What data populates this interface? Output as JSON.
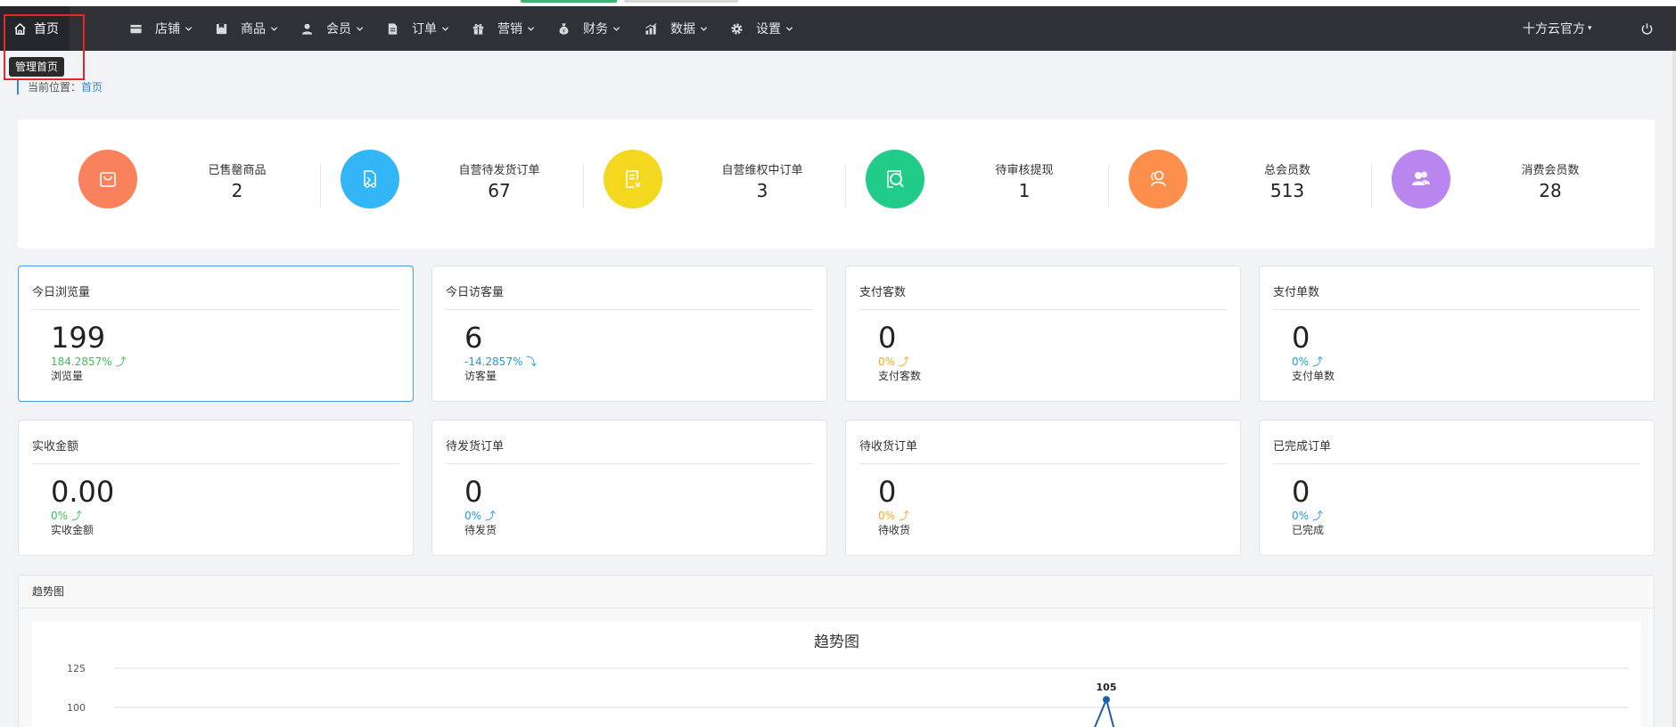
{
  "nav": {
    "home": "首页",
    "items": [
      {
        "label": "店铺",
        "icon": "store-icon"
      },
      {
        "label": "商品",
        "icon": "goods-icon"
      },
      {
        "label": "会员",
        "icon": "member-icon"
      },
      {
        "label": "订单",
        "icon": "order-icon"
      },
      {
        "label": "营销",
        "icon": "gift-icon"
      },
      {
        "label": "财务",
        "icon": "money-bag-icon"
      },
      {
        "label": "数据",
        "icon": "bar-chart-icon"
      },
      {
        "label": "设置",
        "icon": "gear-icon"
      }
    ],
    "account": "十方云官方",
    "tooltip": "管理首页"
  },
  "breadcrumb": {
    "prefix": "当前位置：",
    "link": "首页"
  },
  "stats": [
    {
      "label": "已售罄商品",
      "value": "2",
      "color": "#f9825d",
      "icon": "bag-icon"
    },
    {
      "label": "自营待发货订单",
      "value": "67",
      "color": "#33b6f7",
      "icon": "truck-icon"
    },
    {
      "label": "自营维权中订单",
      "value": "3",
      "color": "#f4d820",
      "icon": "refund-doc-icon"
    },
    {
      "label": "待审核提现",
      "value": "1",
      "color": "#21cb88",
      "icon": "search-doc-icon"
    },
    {
      "label": "总会员数",
      "value": "513",
      "color": "#fd8f4c",
      "icon": "members-icon"
    },
    {
      "label": "消费会员数",
      "value": "28",
      "color": "#b986f0",
      "icon": "users-icon"
    }
  ],
  "cards_row1": [
    {
      "title": "今日浏览量",
      "value": "199",
      "pct": "184.2857% ⤴",
      "pct_color": "#3fbf5b",
      "sub": "浏览量"
    },
    {
      "title": "今日访客量",
      "value": "6",
      "pct": "-14.2857% ⤵",
      "pct_color": "#1e9ad8",
      "sub": "访客量"
    },
    {
      "title": "支付客数",
      "value": "0",
      "pct": "0% ⤴",
      "pct_color": "#f5a623",
      "sub": "支付客数"
    },
    {
      "title": "支付单数",
      "value": "0",
      "pct": "0% ⤴",
      "pct_color": "#1e9ad8",
      "sub": "支付单数"
    }
  ],
  "cards_row2": [
    {
      "title": "实收金额",
      "value": "0.00",
      "pct": "0% ⤴",
      "pct_color": "#3fbf5b",
      "sub": "实收金额"
    },
    {
      "title": "待发货订单",
      "value": "0",
      "pct": "0% ⤴",
      "pct_color": "#1e9ad8",
      "sub": "待发货"
    },
    {
      "title": "待收货订单",
      "value": "0",
      "pct": "0% ⤴",
      "pct_color": "#f5a623",
      "sub": "待收货"
    },
    {
      "title": "已完成订单",
      "value": "0",
      "pct": "0% ⤴",
      "pct_color": "#1e9ad8",
      "sub": "已完成"
    }
  ],
  "trend": {
    "header": "趋势图",
    "chart_title": "趋势图"
  },
  "chart_data": {
    "type": "line",
    "title": "趋势图",
    "y_ticks": [
      100,
      125
    ],
    "ylim": [
      95,
      130
    ],
    "points": [
      {
        "value": 105,
        "label": "105"
      }
    ],
    "line_color": "#1a5ea8"
  }
}
